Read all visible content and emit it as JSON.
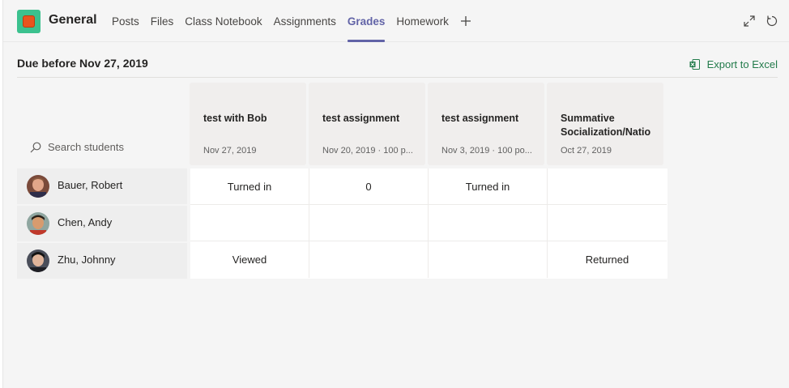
{
  "header": {
    "channel": "General",
    "tabs": [
      {
        "label": "Posts",
        "active": false
      },
      {
        "label": "Files",
        "active": false
      },
      {
        "label": "Class Notebook",
        "active": false
      },
      {
        "label": "Assignments",
        "active": false
      },
      {
        "label": "Grades",
        "active": true
      },
      {
        "label": "Homework",
        "active": false
      }
    ],
    "add_tab_icon": "plus-icon",
    "expand_icon": "expand-icon",
    "refresh_icon": "refresh-icon"
  },
  "due_bar": {
    "title": "Due before Nov 27, 2019",
    "export_label": "Export to Excel",
    "export_icon": "excel-icon"
  },
  "search": {
    "placeholder": "Search students",
    "icon": "search-icon"
  },
  "assignments": [
    {
      "title": "test with Bob",
      "subtitle": "Nov 27, 2019"
    },
    {
      "title": "test assignment",
      "subtitle": "Nov 20, 2019 · 100 p..."
    },
    {
      "title": "test assignment",
      "subtitle": "Nov 3, 2019 · 100 po..."
    },
    {
      "title": "Summative Socialization/Natio",
      "subtitle": "Oct 27, 2019"
    }
  ],
  "students": [
    {
      "name": "Bauer, Robert",
      "grades": [
        "Turned in",
        "0",
        "Turned in",
        ""
      ]
    },
    {
      "name": "Chen, Andy",
      "grades": [
        "",
        "",
        "",
        ""
      ]
    },
    {
      "name": "Zhu, Johnny",
      "grades": [
        "Viewed",
        "",
        "",
        "Returned"
      ]
    }
  ],
  "colors": {
    "accent": "#6264a7",
    "excel_green": "#237b4b",
    "tile_green": "#3bc18e",
    "tile_orange": "#e8541e"
  }
}
